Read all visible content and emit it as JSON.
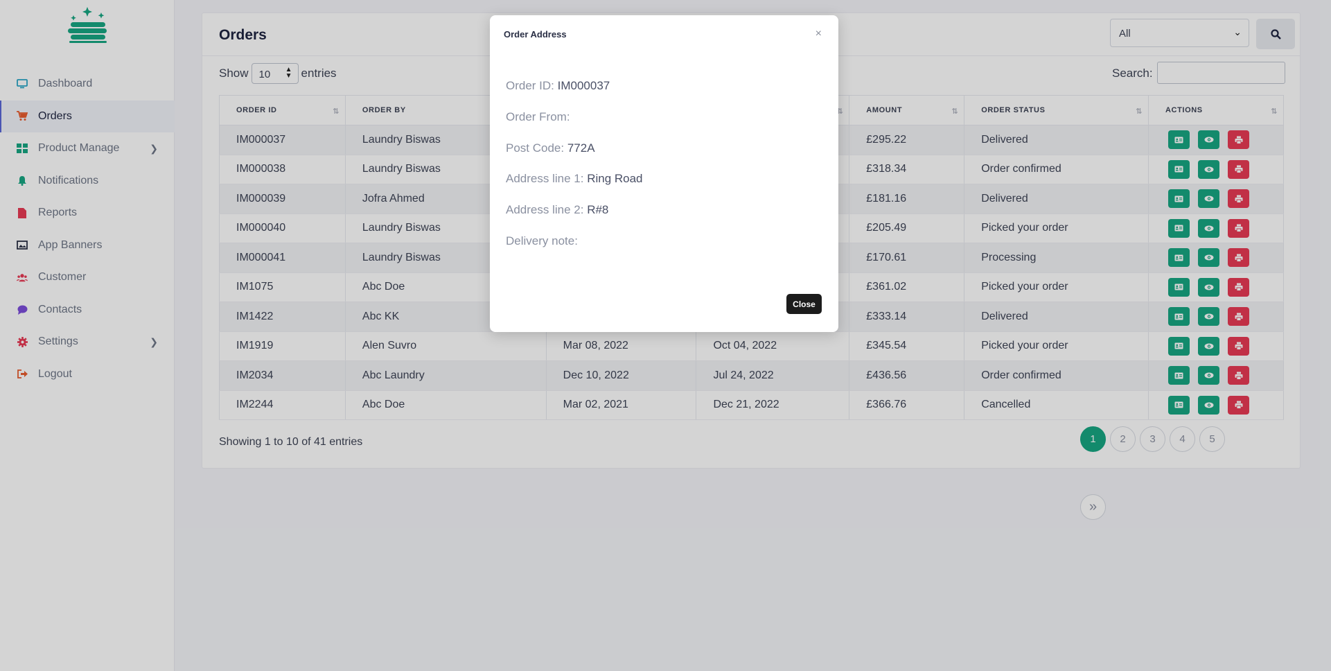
{
  "sidebar": {
    "items": [
      {
        "label": "Dashboard",
        "icon": "monitor-icon",
        "color": "#2aa6c7"
      },
      {
        "label": "Orders",
        "icon": "cart-icon",
        "color": "#e85c2e",
        "active": true
      },
      {
        "label": "Product Manage",
        "icon": "grid-icon",
        "color": "#17a682",
        "has_submenu": true
      },
      {
        "label": "Notifications",
        "icon": "bell-icon",
        "color": "#17a682"
      },
      {
        "label": "Reports",
        "icon": "file-icon",
        "color": "#e83a55"
      },
      {
        "label": "App Banners",
        "icon": "image-icon",
        "color": "#2a2f45"
      },
      {
        "label": "Customer",
        "icon": "users-icon",
        "color": "#e83a55"
      },
      {
        "label": "Contacts",
        "icon": "chat-icon",
        "color": "#7c4ddb"
      },
      {
        "label": "Settings",
        "icon": "gear-icon",
        "color": "#e83a55",
        "has_submenu": true
      },
      {
        "label": "Logout",
        "icon": "logout-icon",
        "color": "#e85c2e"
      }
    ]
  },
  "header": {
    "title": "Orders",
    "status_filter": "All"
  },
  "table_controls": {
    "show_label": "Show",
    "entries_value": "10",
    "entries_label": "entries",
    "search_label": "Search:"
  },
  "table": {
    "columns": [
      "ORDER ID",
      "ORDER BY",
      "",
      "",
      "AMOUNT",
      "ORDER STATUS",
      "ACTIONS"
    ],
    "rows": [
      {
        "id": "IM000037",
        "by": "Laundry Biswas",
        "d1": "",
        "d2": "",
        "amount": "£295.22",
        "status": "Delivered"
      },
      {
        "id": "IM000038",
        "by": "Laundry Biswas",
        "d1": "",
        "d2": "",
        "amount": "£318.34",
        "status": "Order confirmed"
      },
      {
        "id": "IM000039",
        "by": "Jofra Ahmed",
        "d1": "",
        "d2": "",
        "amount": "£181.16",
        "status": "Delivered"
      },
      {
        "id": "IM000040",
        "by": "Laundry Biswas",
        "d1": "",
        "d2": "",
        "amount": "£205.49",
        "status": "Picked your order"
      },
      {
        "id": "IM000041",
        "by": "Laundry Biswas",
        "d1": "",
        "d2": "",
        "amount": "£170.61",
        "status": "Processing"
      },
      {
        "id": "IM1075",
        "by": "Abc Doe",
        "d1": "",
        "d2": "",
        "amount": "£361.02",
        "status": "Picked your order"
      },
      {
        "id": "IM1422",
        "by": "Abc KK",
        "d1": "",
        "d2": "",
        "amount": "£333.14",
        "status": "Delivered"
      },
      {
        "id": "IM1919",
        "by": "Alen Suvro",
        "d1": "Mar 08, 2022",
        "d2": "Oct 04, 2022",
        "amount": "£345.54",
        "status": "Picked your order"
      },
      {
        "id": "IM2034",
        "by": "Abc Laundry",
        "d1": "Dec 10, 2022",
        "d2": "Jul 24, 2022",
        "amount": "£436.56",
        "status": "Order confirmed"
      },
      {
        "id": "IM2244",
        "by": "Abc Doe",
        "d1": "Mar 02, 2021",
        "d2": "Dec 21, 2022",
        "amount": "£366.76",
        "status": "Cancelled"
      }
    ]
  },
  "footer": {
    "showing": "Showing 1 to 10 of 41 entries",
    "pages": [
      "1",
      "2",
      "3",
      "4",
      "5"
    ],
    "first": "«",
    "last": "»"
  },
  "modal": {
    "title": "Order Address",
    "close_x": "×",
    "fields": [
      {
        "label": "Order ID:",
        "value": "IM000037"
      },
      {
        "label": "Order From:",
        "value": ""
      },
      {
        "label": "Post Code:",
        "value": "772A"
      },
      {
        "label": "Address line 1:",
        "value": "Ring Road"
      },
      {
        "label": "Address line 2:",
        "value": "R#8"
      },
      {
        "label": "Delivery note:",
        "value": ""
      }
    ],
    "close_button": "Close"
  },
  "colors": {
    "accent": "#17a682",
    "danger": "#e83a55"
  }
}
